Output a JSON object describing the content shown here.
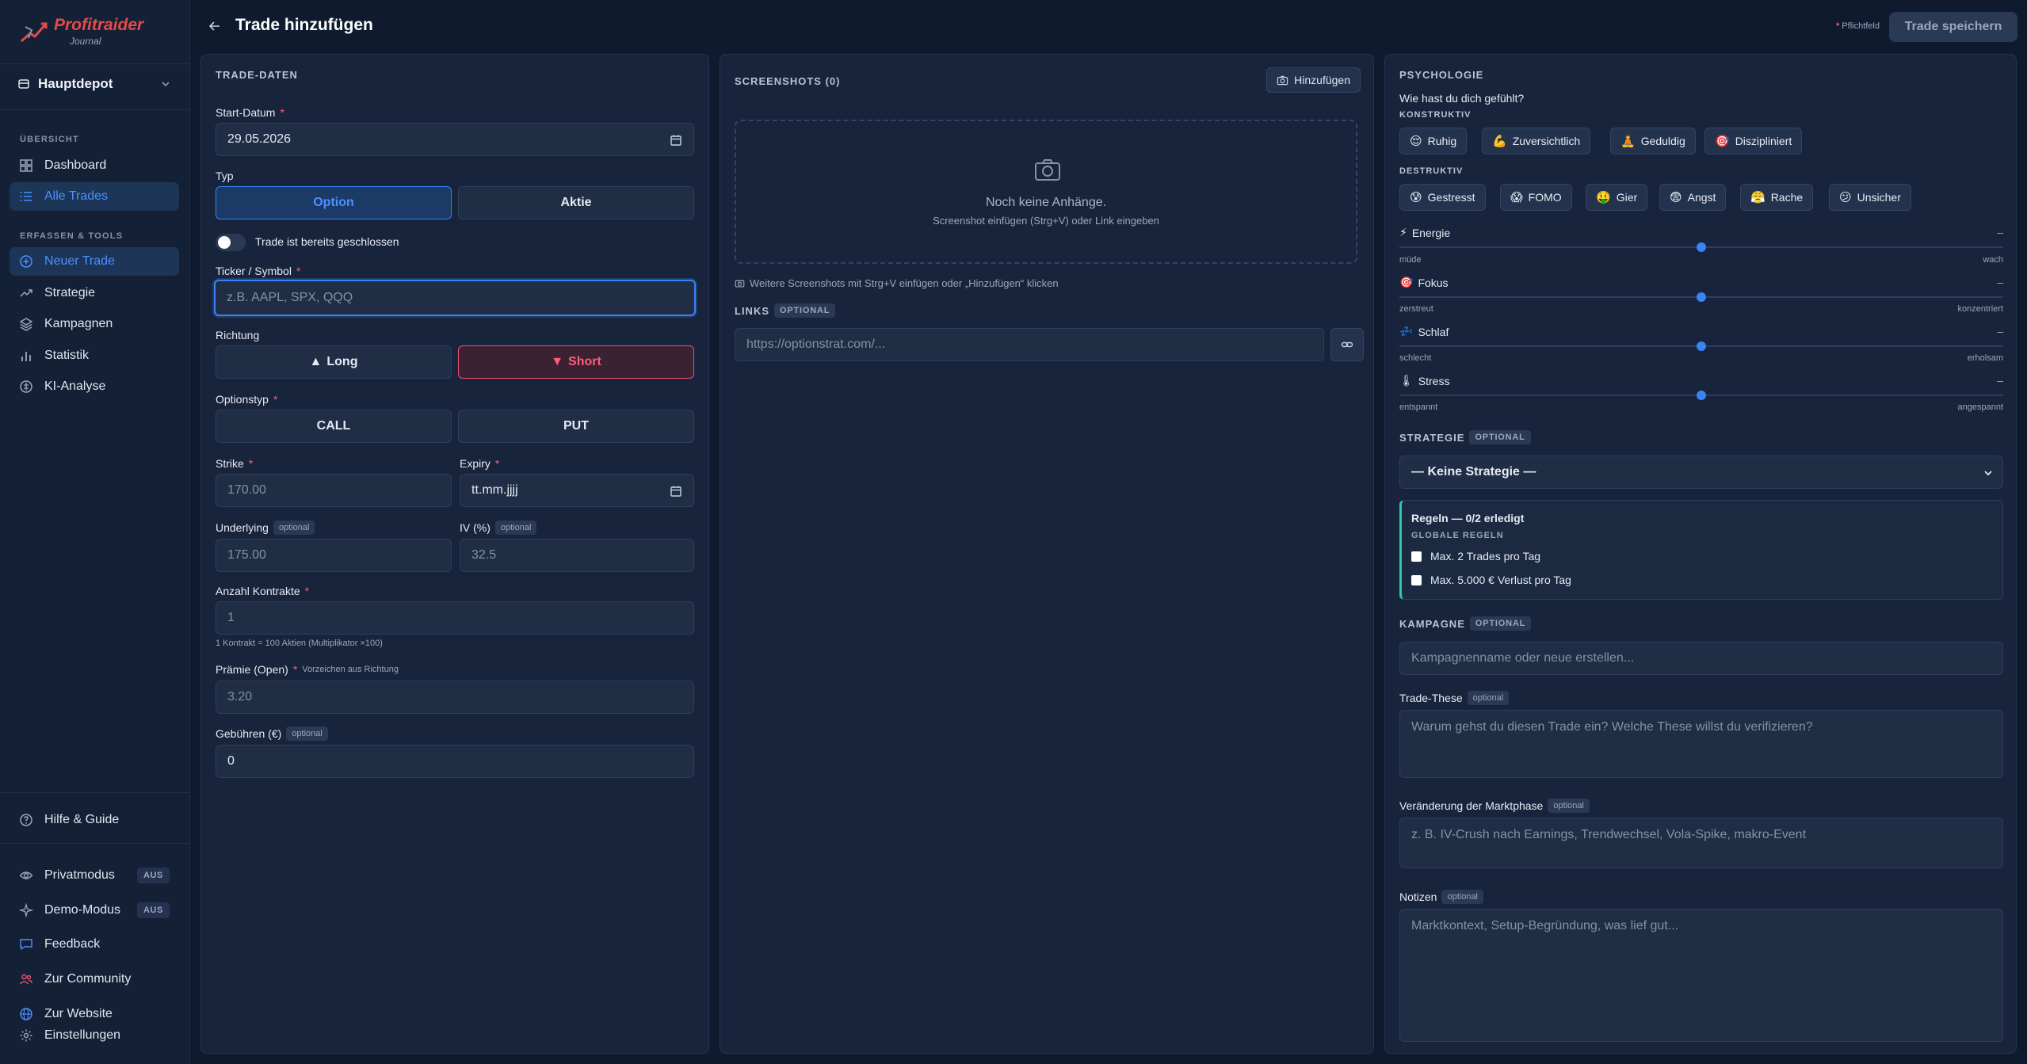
{
  "app": {
    "name": "Profitraider",
    "subtitle": "Journal"
  },
  "sidebar": {
    "depot": "Hauptdepot",
    "sections": {
      "overview": "ÜBERSICHT",
      "tools": "ERFASSEN & TOOLS"
    },
    "items": {
      "dashboard": "Dashboard",
      "all_trades": "Alle Trades",
      "new_trade": "Neuer Trade",
      "strategy": "Strategie",
      "campaigns": "Kampagnen",
      "statistics": "Statistik",
      "ai": "KI-Analyse",
      "help": "Hilfe & Guide",
      "privacy": "Privatmodus",
      "demo": "Demo-Modus",
      "feedback": "Feedback",
      "community": "Zur Community",
      "website": "Zur Website",
      "settings": "Einstellungen"
    },
    "privacy_state": "AUS",
    "demo_state": "AUS"
  },
  "header": {
    "title": "Trade hinzufügen",
    "required_mark": "*",
    "required_note": "Pflichtfeld",
    "save_label": "Trade speichern"
  },
  "trade": {
    "heading": "TRADE-DATEN",
    "start_date_label": "Start-Datum",
    "start_date_value": "29.05.2026",
    "type_label": "Typ",
    "type_options": [
      "Option",
      "Aktie"
    ],
    "type_selected": "Option",
    "closed_toggle_label": "Trade ist bereits geschlossen",
    "ticker_label": "Ticker / Symbol",
    "ticker_placeholder": "z.B. AAPL, SPX, QQQ",
    "direction_label": "Richtung",
    "direction_long": "Long",
    "direction_short": "Short",
    "direction_selected": "Short",
    "option_type_label": "Optionstyp",
    "call": "CALL",
    "put": "PUT",
    "strike_label": "Strike",
    "strike_placeholder": "170.00",
    "expiry_label": "Expiry",
    "expiry_placeholder": "tt.mm.jjjj",
    "underlying_label": "Underlying",
    "underlying_placeholder": "175.00",
    "iv_label": "IV (%)",
    "iv_placeholder": "32.5",
    "optional": "optional",
    "contracts_label": "Anzahl Kontrakte",
    "contracts_placeholder": "1",
    "contracts_hint": "1 Kontrakt = 100 Aktien (Multiplikator ×100)",
    "premium_label": "Prämie (Open)",
    "premium_hint": "Vorzeichen aus Richtung",
    "premium_placeholder": "3.20",
    "fees_label": "Gebühren (€)",
    "fees_value": "0"
  },
  "screenshots": {
    "heading": "SCREENSHOTS (0)",
    "add_label": "Hinzufügen",
    "empty_title": "Noch keine Anhänge.",
    "empty_hint": "Screenshot einfügen (Strg+V) oder Link eingeben",
    "more_hint": "Weitere Screenshots mit Strg+V einfügen oder „Hinzufügen“ klicken",
    "links_heading": "LINKS",
    "optional_caps": "OPTIONAL",
    "link_placeholder": "https://optionstrat.com/..."
  },
  "psychology": {
    "heading": "PSYCHOLOGIE",
    "question": "Wie hast du dich gefühlt?",
    "constructive_label": "KONSTRUKTIV",
    "constructive": [
      {
        "emoji": "😌",
        "label": "Ruhig"
      },
      {
        "emoji": "💪",
        "label": "Zuversichtlich"
      },
      {
        "emoji": "🧘",
        "label": "Geduldig"
      },
      {
        "emoji": "🎯",
        "label": "Diszipliniert"
      }
    ],
    "destructive_label": "DESTRUKTIV",
    "destructive": [
      {
        "emoji": "😰",
        "label": "Gestresst"
      },
      {
        "emoji": "😱",
        "label": "FOMO"
      },
      {
        "emoji": "🤑",
        "label": "Gier"
      },
      {
        "emoji": "😨",
        "label": "Angst"
      },
      {
        "emoji": "😤",
        "label": "Rache"
      },
      {
        "emoji": "😕",
        "label": "Unsicher"
      }
    ],
    "sliders": [
      {
        "emoji": "⚡",
        "label": "Energie",
        "value": "–",
        "min": "müde",
        "max": "wach",
        "level": 0.5
      },
      {
        "emoji": "🎯",
        "label": "Fokus",
        "value": "–",
        "min": "zerstreut",
        "max": "konzentriert",
        "level": 0.5
      },
      {
        "emoji": "💤",
        "label": "Schlaf",
        "value": "–",
        "min": "schlecht",
        "max": "erholsam",
        "level": 0.5
      },
      {
        "emoji": "🌡",
        "label": "Stress",
        "value": "–",
        "min": "entspannt",
        "max": "angespannt",
        "level": 0.5
      }
    ]
  },
  "strategy": {
    "heading": "STRATEGIE",
    "optional_caps": "OPTIONAL",
    "selected": "— Keine Strategie —",
    "rules_title": "Regeln — 0/2 erledigt",
    "global_rules_label": "GLOBALE REGELN",
    "rules": [
      "Max. 2 Trades pro Tag",
      "Max. 5.000 € Verlust pro Tag"
    ]
  },
  "campaign": {
    "heading": "KAMPAGNE",
    "optional_caps": "OPTIONAL",
    "placeholder": "Kampagnenname oder neue erstellen..."
  },
  "thesis": {
    "label": "Trade-These",
    "optional": "optional",
    "placeholder": "Warum gehst du diesen Trade ein? Welche These willst du verifizieren?"
  },
  "market": {
    "label": "Veränderung der Marktphase",
    "optional": "optional",
    "placeholder": "z. B. IV-Crush nach Earnings, Trendwechsel, Vola-Spike, makro-Event"
  },
  "notes": {
    "label": "Notizen",
    "optional": "optional",
    "placeholder": "Marktkontext, Setup-Begründung, was lief gut..."
  },
  "colors": {
    "accent": "#3b82f6",
    "danger": "#f0506e",
    "teal": "#2fc8b0",
    "logo": "#e34b4b"
  },
  "icons": [
    "logo-icon",
    "wallet-icon",
    "chevron-down-icon",
    "grid-icon",
    "list-icon",
    "plus-circle-icon",
    "trend-icon",
    "layers-icon",
    "bar-chart-icon",
    "ai-icon",
    "help-icon",
    "eye-icon",
    "sparkle-icon",
    "chat-icon",
    "users-icon",
    "globe-icon",
    "gear-icon",
    "arrow-left-icon",
    "calendar-icon",
    "camera-icon",
    "link-icon"
  ]
}
